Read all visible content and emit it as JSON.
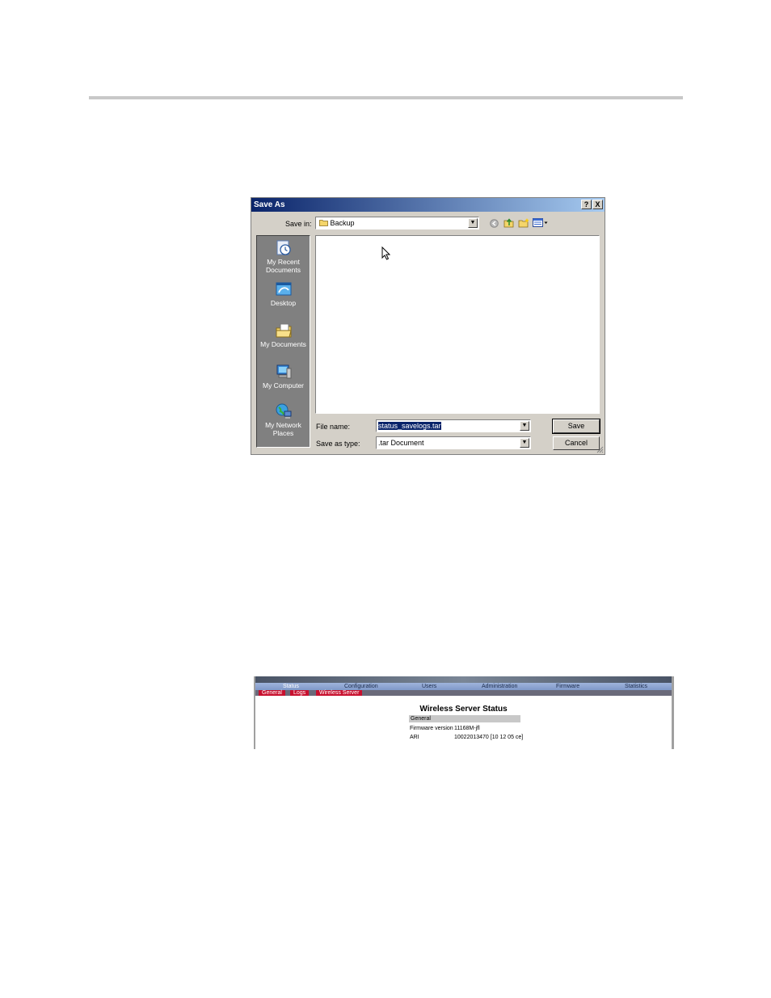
{
  "dialog": {
    "title": "Save As",
    "help_btn": "?",
    "close_btn": "X",
    "save_in_label": "Save in:",
    "save_in_value": "Backup",
    "places": [
      {
        "icon": "recent-documents-icon",
        "label": "My Recent Documents"
      },
      {
        "icon": "desktop-icon",
        "label": "Desktop"
      },
      {
        "icon": "my-documents-icon",
        "label": "My Documents"
      },
      {
        "icon": "my-computer-icon",
        "label": "My Computer"
      },
      {
        "icon": "network-places-icon",
        "label": "My Network Places"
      }
    ],
    "file_name_label": "File name:",
    "file_name_value": "status_savelogs.tar",
    "save_type_label": "Save as type:",
    "save_type_value": ".tar Document",
    "save_btn": "Save",
    "cancel_btn": "Cancel"
  },
  "status_page": {
    "nav": [
      "Status",
      "Configuration",
      "Users",
      "Administration",
      "Firmware",
      "Statistics"
    ],
    "subnav": [
      "General",
      "Logs",
      "Wireless Server"
    ],
    "heading": "Wireless Server Status",
    "section": "General",
    "rows": [
      {
        "label": "Firmware version",
        "value": "11168M-jfl"
      },
      {
        "label": "ARI",
        "value": "10022013470 [10 12 05 ce]"
      }
    ]
  }
}
